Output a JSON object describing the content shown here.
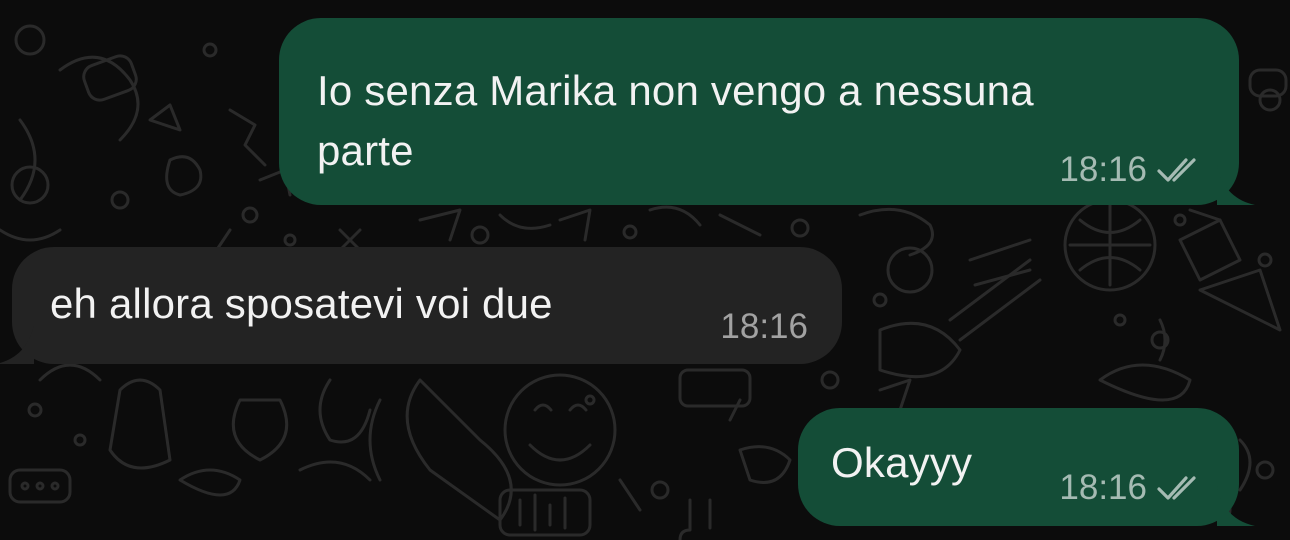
{
  "conversation": {
    "messages": [
      {
        "direction": "outgoing",
        "text": "Io senza Marika non vengo a nessuna parte",
        "line1": "Io senza Marika non vengo a nessuna",
        "line2": "parte",
        "time": "18:16",
        "status_icon": "double-check-icon"
      },
      {
        "direction": "incoming",
        "text": "eh allora sposatevi voi due",
        "time": "18:16"
      },
      {
        "direction": "outgoing",
        "text": "Okayyy",
        "time": "18:16",
        "status_icon": "double-check-icon"
      }
    ]
  },
  "colors": {
    "background": "#0c0c0c",
    "outgoing_bubble": "#144d37",
    "incoming_bubble": "#232323",
    "text": "#f2f2f2",
    "meta_text": "#9aa39f"
  }
}
